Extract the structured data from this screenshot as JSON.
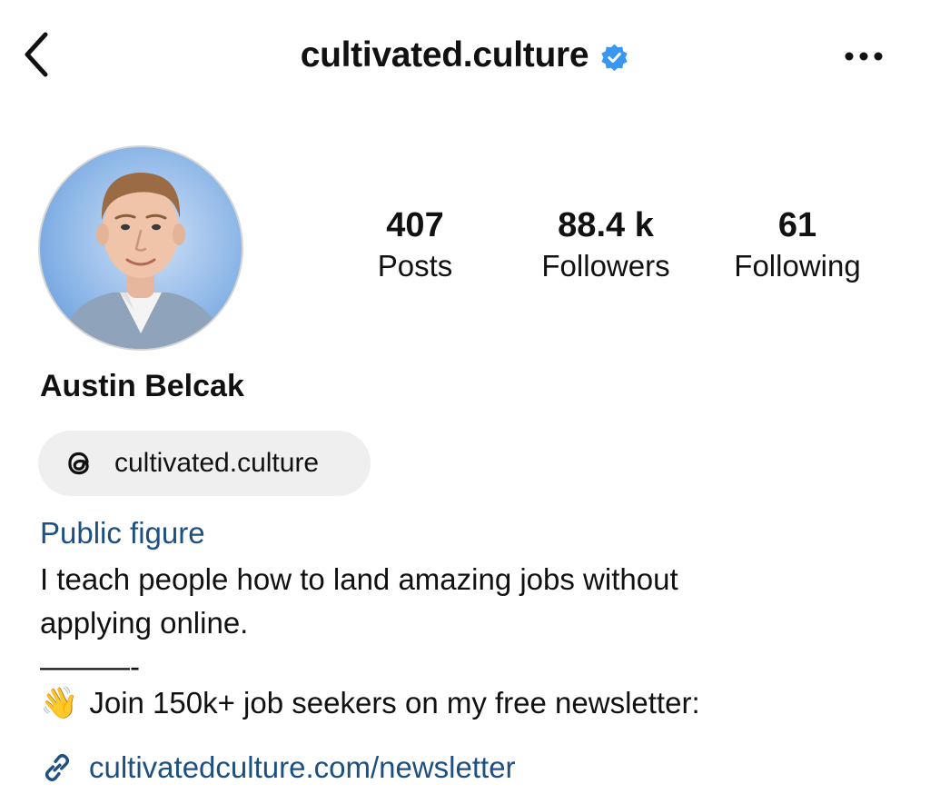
{
  "header": {
    "username": "cultivated.culture",
    "verified": true,
    "icons": {
      "back": "chevron-left-icon",
      "more": "more-horizontal-icon",
      "verified": "verified-badge-icon"
    }
  },
  "profile": {
    "avatar_alt": "profile picture",
    "stats": [
      {
        "value": "407",
        "label": "Posts"
      },
      {
        "value": "88.4 k",
        "label": "Followers"
      },
      {
        "value": "61",
        "label": "Following"
      }
    ],
    "name": "Austin Belcak",
    "threads": {
      "handle": "cultivated.culture",
      "icon": "threads-icon"
    },
    "category": "Public figure",
    "bio_lines": [
      "I teach people how to land amazing jobs without",
      "applying online.",
      "———-"
    ],
    "newsletter_emoji": "👋",
    "newsletter_text": "Join 150k+ job seekers on my free newsletter:",
    "link": {
      "text": "cultivatedculture.com/newsletter",
      "icon": "link-icon"
    }
  },
  "colors": {
    "verified_blue": "#3897f0",
    "link_blue": "#1d4f82",
    "pill_bg": "#efefef"
  }
}
